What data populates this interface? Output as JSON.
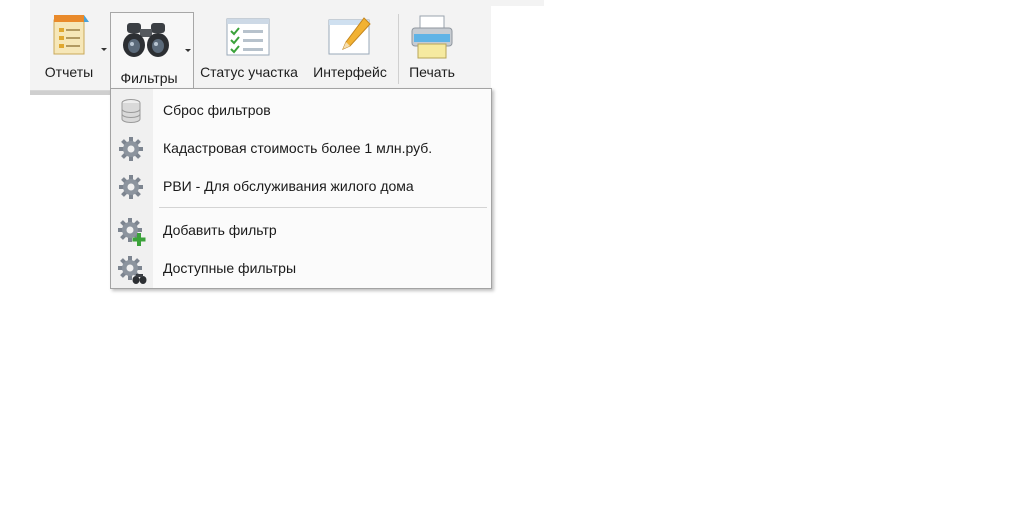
{
  "ribbon": {
    "buttons": [
      {
        "label": "Отчеты",
        "icon": "reports-icon"
      },
      {
        "label": "Фильтры",
        "icon": "binoculars-icon"
      },
      {
        "label": "Статус участка",
        "icon": "status-checklist-icon"
      },
      {
        "label": "Интерфейс",
        "icon": "interface-pencil-icon"
      },
      {
        "label": "Печать",
        "icon": "printer-icon"
      }
    ]
  },
  "filters_menu": {
    "items": [
      {
        "label": "Сброс фильтров",
        "icon": "database-icon"
      },
      {
        "label": "Кадастровая стоимость более 1 млн.руб.",
        "icon": "gear-icon"
      },
      {
        "label": "РВИ - Для обслуживания жилого дома",
        "icon": "gear-icon"
      },
      {
        "label": "Добавить фильтр",
        "icon": "gear-add-icon"
      },
      {
        "label": "Доступные фильтры",
        "icon": "gear-binoculars-icon"
      }
    ]
  },
  "colors": {
    "accent": "#2a7bd4",
    "gear": "#7d8590",
    "add": "#3aa23a"
  }
}
